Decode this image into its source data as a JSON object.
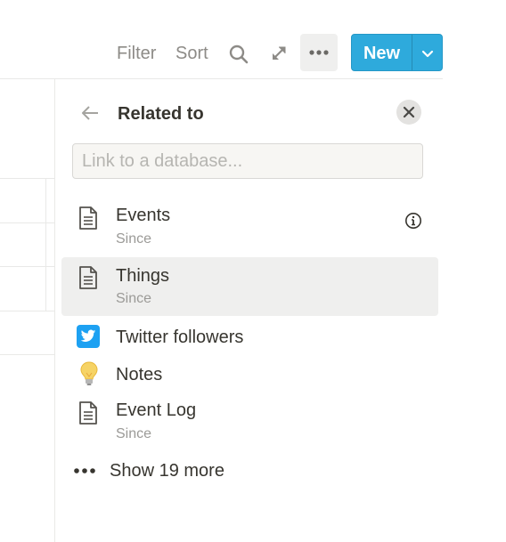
{
  "toolbar": {
    "filter_label": "Filter",
    "sort_label": "Sort",
    "search_icon": "search-icon",
    "expand_icon": "expand-icon",
    "more_icon": "more-horizontal-icon",
    "new_label": "New",
    "new_chevron_icon": "chevron-down-icon",
    "accent_color": "#2eaadc"
  },
  "panel": {
    "title": "Related to",
    "back_icon": "arrow-left-icon",
    "close_icon": "close-icon",
    "search": {
      "placeholder": "Link to a database...",
      "value": ""
    },
    "items": [
      {
        "label": "Events",
        "sublabel": "Since",
        "icon": "page-icon",
        "info_icon": true,
        "selected": false
      },
      {
        "label": "Things",
        "sublabel": "Since",
        "icon": "page-icon",
        "selected": true
      },
      {
        "label": "Twitter followers",
        "icon": "twitter-icon"
      },
      {
        "label": "Notes",
        "icon": "lightbulb-icon"
      },
      {
        "label": "Event Log",
        "sublabel": "Since",
        "icon": "page-icon"
      }
    ],
    "show_more_label": "Show 19 more",
    "show_more_icon": "more-horizontal-icon"
  }
}
